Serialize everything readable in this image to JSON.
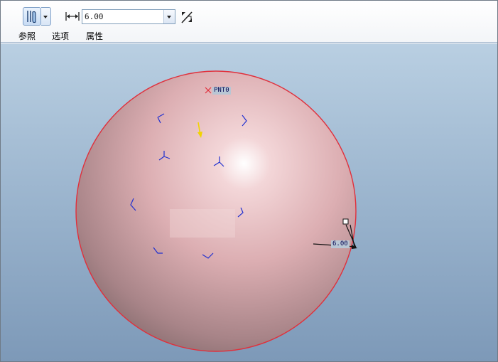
{
  "dashboard": {
    "depth_value": "6.00",
    "tabs": {
      "references": "参照",
      "options": "选项",
      "properties": "属性"
    },
    "icons": {
      "thicken_type": "thicken-surface-icon",
      "width": "width-dimension-icon",
      "flip": "flip-direction-icon"
    }
  },
  "model": {
    "point_label": "PNT0",
    "dimension_label": "6.00",
    "surface_color": "#e8b8bc",
    "edge_color": "#e0303c",
    "background_top": "#b9cfe2",
    "background_bottom": "#7d99b8"
  }
}
